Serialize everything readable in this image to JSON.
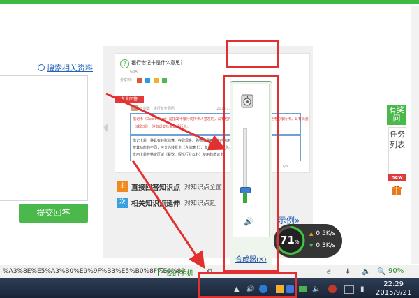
{
  "page": {
    "search_link": "搜索相关资料",
    "submit_button": "提交回答"
  },
  "example": {
    "question_title": "银行借记卡是什么意思？",
    "question_meta": "GBA",
    "share_label": "分享到：",
    "answer_tag": "专业回答",
    "answer_author": "王彬乾",
    "answer_author_title": "银行专业顾问",
    "answer_time": "2015.11.30 15:39",
    "line1a": "借记卡（Debit Card）是指发卡银行向持卡人签发的，没有信用额度，持卡人先存款、后使用的银行卡。具有消费",
    "line1b": "（或取现），没有透支功能的银行卡。",
    "line2": "借记卡是一种具有转账结算、存取现金、购物消费等功能的信用工具，借记卡不能透支。",
    "line3": "按其功能的不同，可分为转账卡（含储蓄卡）、专用卡及储值卡。",
    "line4": "专用卡是在特定区域（餐饮、娱乐行业以外）使用的借记卡。",
    "page_num": "1/3",
    "kp1_icon": "主",
    "kp1_title": "直接回答知识点",
    "kp1_desc": "对知识点全面",
    "kp2_icon": "次",
    "kp2_title": "相关知识点延伸",
    "kp2_desc": "对知识点延",
    "example_link": "示例»"
  },
  "float": {
    "ask_label": "有奖问",
    "tasklist_label": "任务列表",
    "new_badge": "new"
  },
  "mixer": {
    "button_label": "合成器(X)",
    "volume_level": 0.12
  },
  "speed": {
    "percent": "71",
    "percent_unit": "%",
    "upload": "0.5K/s",
    "download": "0.3K/s"
  },
  "statusbar": {
    "url": "%A3%8E%E5%A3%B0%E9%9F%B3%E5%B0%8F%E6%80",
    "phone": "我的手机",
    "zoom": "90%"
  },
  "taskbar": {
    "time": "22:29",
    "date": "2015/9/21"
  },
  "colors": {
    "accent_green": "#3fb93f",
    "annotation_red": "#e23030",
    "link_blue": "#2762b8"
  }
}
